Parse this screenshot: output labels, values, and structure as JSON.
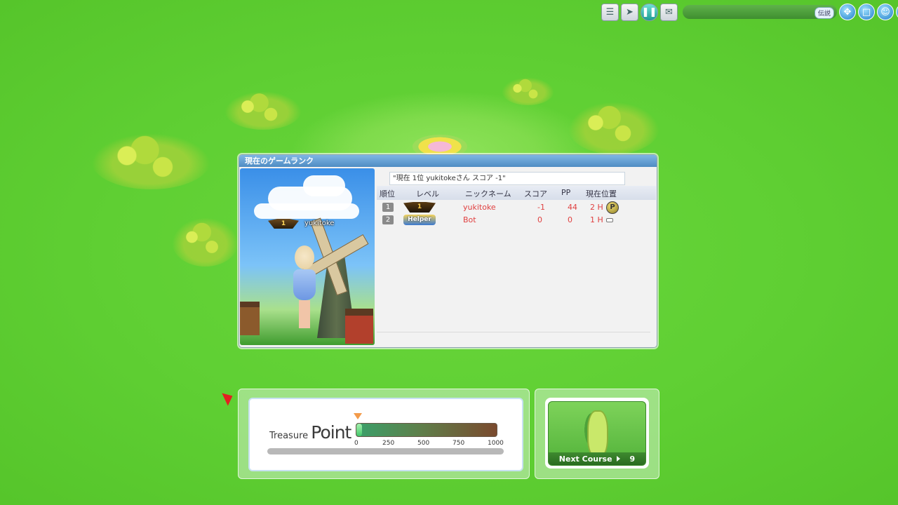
{
  "topbar": {
    "chat_tag": "伝説"
  },
  "ranking": {
    "title": "現在のゲームランク",
    "message": "\"現在 1位 yukitokeさん スコア -1\"",
    "portrait": {
      "badge": "1",
      "name": "yukitoke"
    },
    "columns": [
      "順位",
      "レベル",
      "ニックネーム",
      "スコア",
      "PP",
      "現在位置"
    ],
    "rows": [
      {
        "rank": "1",
        "level_badge": "1",
        "nickname": "yukitoke",
        "score": "-1",
        "pp": "44",
        "position": "2 H",
        "position_icon": "P"
      },
      {
        "rank": "2",
        "level_badge": "Helper",
        "nickname": "Bot",
        "score": "0",
        "pp": "0",
        "position": "1 H",
        "position_icon": ""
      }
    ]
  },
  "treasure": {
    "title_small": "Treasure",
    "title_big": "Point",
    "value": 0,
    "max": 1000,
    "ticks": [
      "0",
      "250",
      "500",
      "750",
      "1000"
    ]
  },
  "next_course": {
    "label": "Next Course",
    "number": "9"
  },
  "colors": {
    "grass": "#5fcf33",
    "score_red": "#e04040",
    "panel_title": "#4f8cc3"
  }
}
